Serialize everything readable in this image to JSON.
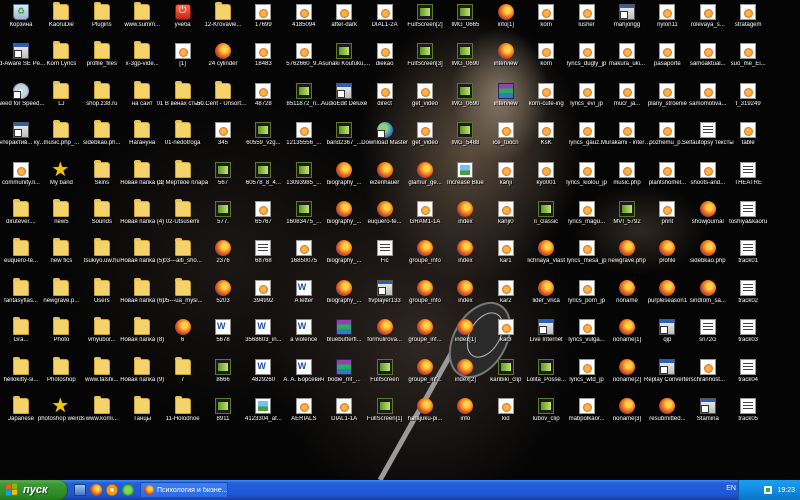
{
  "desktop": {
    "columns": [
      [
        {
          "label": "Корзина",
          "icon": "recycle-bin-icon"
        },
        {
          "label": "Ad-Aware SE Personal",
          "icon": "app-shortcut-icon"
        },
        {
          "label": "Need for Speed...",
          "icon": "game-shortcut-icon"
        },
        {
          "label": "Интерактив... курс игры...",
          "icon": "app-shortcut-icon"
        },
        {
          "label": "community.li...",
          "icon": "html-file-icon"
        },
        {
          "label": "dirutever....",
          "icon": "folder-icon"
        },
        {
          "label": "euquero-te...",
          "icon": "folder-icon"
        },
        {
          "label": "fantasyflas...",
          "icon": "folder-icon"
        },
        {
          "label": "Gra...",
          "icon": "folder-icon"
        },
        {
          "label": "hellokitty-si...",
          "icon": "folder-icon"
        },
        {
          "label": "Japanese",
          "icon": "folder-icon"
        }
      ],
      [
        {
          "label": "KaoruDie",
          "icon": "folder-icon"
        },
        {
          "label": "Korn Lyrics",
          "icon": "folder-icon"
        },
        {
          "label": "LJ",
          "icon": "folder-icon"
        },
        {
          "label": "music.php_...",
          "icon": "folder-icon"
        },
        {
          "label": "My band",
          "icon": "star-icon"
        },
        {
          "label": "new5",
          "icon": "folder-icon"
        },
        {
          "label": "new fics",
          "icon": "folder-icon"
        },
        {
          "label": "newgrave.p...",
          "icon": "folder-icon"
        },
        {
          "label": "Photo",
          "icon": "folder-icon"
        },
        {
          "label": "Photoshop",
          "icon": "folder-icon"
        },
        {
          "label": "photoshop weirds",
          "icon": "star-icon"
        }
      ],
      [
        {
          "label": "Plugins",
          "icon": "folder-icon"
        },
        {
          "label": "profile_files",
          "icon": "folder-icon"
        },
        {
          "label": "shop.z38.ru",
          "icon": "folder-icon"
        },
        {
          "label": "sidebkao.ph...",
          "icon": "folder-icon"
        },
        {
          "label": "Skins",
          "icon": "folder-icon"
        },
        {
          "label": "Sounds",
          "icon": "folder-icon"
        },
        {
          "label": "tsukiyo.uw.hu",
          "icon": "folder-icon"
        },
        {
          "label": "Users",
          "icon": "folder-icon"
        },
        {
          "label": "vmyubor...",
          "icon": "folder-icon"
        },
        {
          "label": "www.falshi...",
          "icon": "folder-icon"
        },
        {
          "label": "www.komi...",
          "icon": "folder-icon"
        }
      ],
      [
        {
          "label": "www.summ...",
          "icon": "folder-icon"
        },
        {
          "label": "x-3gp-vide...",
          "icon": "folder-icon"
        },
        {
          "label": "на сайт",
          "icon": "folder-icon"
        },
        {
          "label": "Нагануна",
          "icon": "folder-icon"
        },
        {
          "label": "Новая папка (3)",
          "icon": "folder-icon"
        },
        {
          "label": "Новая папка (4)",
          "icon": "folder-icon"
        },
        {
          "label": "Новая папка (5)",
          "icon": "folder-icon"
        },
        {
          "label": "Новая папка (6)",
          "icon": "folder-icon"
        },
        {
          "label": "Новая папка (8)",
          "icon": "folder-icon"
        },
        {
          "label": "Новая папка (9)",
          "icon": "folder-icon"
        },
        {
          "label": "Танцы",
          "icon": "folder-icon"
        }
      ],
      [
        {
          "label": "учеба",
          "icon": "app-icon"
        },
        {
          "label": "[1]",
          "icon": "html-file-icon"
        },
        {
          "label": "01 В венах стынет ртуть",
          "icon": "folder-icon"
        },
        {
          "label": "01-nedotroga",
          "icon": "folder-icon"
        },
        {
          "label": "02 Мертвое плаpа",
          "icon": "folder-icon"
        },
        {
          "label": "02-Utsusemi",
          "icon": "folder-icon"
        },
        {
          "label": "03---aiti_sho...",
          "icon": "folder-icon"
        },
        {
          "label": "05---ua_mysi...",
          "icon": "folder-icon"
        },
        {
          "label": "6",
          "icon": "firefox-icon"
        },
        {
          "label": "7",
          "icon": "folder-icon"
        },
        {
          "label": "11-Holodnoe",
          "icon": "folder-icon"
        }
      ],
      [
        {
          "label": "12-Krovavie...",
          "icon": "folder-icon"
        },
        {
          "label": "24 cylinder",
          "icon": "firefox-icon"
        },
        {
          "label": "50 Cent - Unsorted ...",
          "icon": "folder-icon"
        },
        {
          "label": "345",
          "icon": "html-file-icon"
        },
        {
          "label": "567",
          "icon": "media-file-icon"
        },
        {
          "label": "577.",
          "icon": "media-file-icon"
        },
        {
          "label": "2376",
          "icon": "firefox-icon"
        },
        {
          "label": "5203",
          "icon": "firefox-icon"
        },
        {
          "label": "5678",
          "icon": "word-doc-icon"
        },
        {
          "label": "8666",
          "icon": "media-file-icon"
        },
        {
          "label": "8911",
          "icon": "media-file-icon"
        }
      ],
      [
        {
          "label": "17699",
          "icon": "html-file-icon"
        },
        {
          "label": "18483",
          "icon": "html-file-icon"
        },
        {
          "label": "48728",
          "icon": "html-file-icon"
        },
        {
          "label": "60559_vzg...",
          "icon": "media-file-icon"
        },
        {
          "label": "60578_8_4...",
          "icon": "media-file-icon"
        },
        {
          "label": "65767",
          "icon": "html-file-icon"
        },
        {
          "label": "68768",
          "icon": "text-file-icon"
        },
        {
          "label": "394992",
          "icon": "html-file-icon"
        },
        {
          "label": "3568603_in...",
          "icon": "word-doc-icon"
        },
        {
          "label": "4829260",
          "icon": "word-doc-icon"
        },
        {
          "label": "4123304_af...",
          "icon": "image-file-icon"
        }
      ],
      [
        {
          "label": "4185094",
          "icon": "html-file-icon"
        },
        {
          "label": "5762660_9...",
          "icon": "html-file-icon"
        },
        {
          "label": "8511872_n...",
          "icon": "media-file-icon"
        },
        {
          "label": "12135556_...",
          "icon": "html-file-icon"
        },
        {
          "label": "13093985_...",
          "icon": "media-file-icon"
        },
        {
          "label": "16083475_...",
          "icon": "media-file-icon"
        },
        {
          "label": "16850075",
          "icon": "html-file-icon"
        },
        {
          "label": "A letter",
          "icon": "word-doc-icon"
        },
        {
          "label": "a violence",
          "icon": "word-doc-icon"
        },
        {
          "label": "A. A. Борсевич",
          "icon": "word-doc-icon"
        },
        {
          "label": "AERIALS",
          "icon": "html-file-icon"
        }
      ],
      [
        {
          "label": "after-dark",
          "icon": "html-file-icon"
        },
        {
          "label": "Asunaki Koufuku,...",
          "icon": "media-file-icon"
        },
        {
          "label": "AudioEdit Deluxe",
          "icon": "app-shortcut-icon"
        },
        {
          "label": "band2367_...",
          "icon": "media-file-icon"
        },
        {
          "label": "biography_...",
          "icon": "firefox-icon"
        },
        {
          "label": "biography_...",
          "icon": "firefox-icon"
        },
        {
          "label": "biography_...",
          "icon": "firefox-icon"
        },
        {
          "label": "biography_...",
          "icon": "firefox-icon"
        },
        {
          "label": "bluebutterfl...",
          "icon": "winrar-archive-icon"
        },
        {
          "label": "bodie_mf_...",
          "icon": "winrar-archive-icon"
        },
        {
          "label": "DIAL1-1A",
          "icon": "html-file-icon"
        }
      ],
      [
        {
          "label": "DIAL1-2A",
          "icon": "html-file-icon"
        },
        {
          "label": "diekao",
          "icon": "html-file-icon"
        },
        {
          "label": "direct",
          "icon": "html-file-icon"
        },
        {
          "label": "Download Master",
          "icon": "globe-icon"
        },
        {
          "label": "eizenhauer",
          "icon": "firefox-icon"
        },
        {
          "label": "euquero-te...",
          "icon": "firefox-icon"
        },
        {
          "label": "Fic",
          "icon": "text-file-icon"
        },
        {
          "label": "flvplayer133",
          "icon": "app-shortcut-icon"
        },
        {
          "label": "formulirova...",
          "icon": "firefox-icon"
        },
        {
          "label": "FullScreen",
          "icon": "media-file-icon"
        },
        {
          "label": "FullScreen[1]",
          "icon": "media-file-icon"
        }
      ],
      [
        {
          "label": "FullScreen[2]",
          "icon": "media-file-icon"
        },
        {
          "label": "FullScreen[3]",
          "icon": "media-file-icon"
        },
        {
          "label": "get_video",
          "icon": "html-file-icon"
        },
        {
          "label": "get_video",
          "icon": "html-file-icon"
        },
        {
          "label": "glamur_ge...",
          "icon": "firefox-icon"
        },
        {
          "label": "GRAM1-1A",
          "icon": "html-file-icon"
        },
        {
          "label": "groupe_info",
          "icon": "firefox-icon"
        },
        {
          "label": "groupe_info",
          "icon": "firefox-icon"
        },
        {
          "label": "groupe_inf...",
          "icon": "firefox-icon"
        },
        {
          "label": "groupe_inf...",
          "icon": "firefox-icon"
        },
        {
          "label": "harajuku-pi...",
          "icon": "firefox-icon"
        }
      ],
      [
        {
          "label": "IMG_0665",
          "icon": "media-file-icon"
        },
        {
          "label": "IMG_0690",
          "icon": "media-file-icon"
        },
        {
          "label": "IMG_0690",
          "icon": "media-file-icon"
        },
        {
          "label": "IMG_5488",
          "icon": "media-file-icon"
        },
        {
          "label": "Increase Blue",
          "icon": "image-file-icon"
        },
        {
          "label": "index",
          "icon": "firefox-icon"
        },
        {
          "label": "index",
          "icon": "firefox-icon"
        },
        {
          "label": "index",
          "icon": "firefox-icon"
        },
        {
          "label": "index[1]",
          "icon": "firefox-icon"
        },
        {
          "label": "index[2]",
          "icon": "firefox-icon"
        },
        {
          "label": "info",
          "icon": "firefox-icon"
        }
      ],
      [
        {
          "label": "info[1]",
          "icon": "firefox-icon"
        },
        {
          "label": "interview",
          "icon": "firefox-icon"
        },
        {
          "label": "interview",
          "icon": "winrar-archive-icon"
        },
        {
          "label": "ice_tuocn",
          "icon": "html-file-icon"
        },
        {
          "label": "kanji",
          "icon": "html-file-icon"
        },
        {
          "label": "kanji0",
          "icon": "html-file-icon"
        },
        {
          "label": "kar1",
          "icon": "html-file-icon"
        },
        {
          "label": "kar2",
          "icon": "html-file-icon"
        },
        {
          "label": "kar3",
          "icon": "html-file-icon"
        },
        {
          "label": "karibiki_clip",
          "icon": "media-file-icon"
        },
        {
          "label": "kid",
          "icon": "html-file-icon"
        }
      ],
      [
        {
          "label": "korn",
          "icon": "html-file-icon"
        },
        {
          "label": "korn",
          "icon": "html-file-icon"
        },
        {
          "label": "korn-cute-ing",
          "icon": "html-file-icon"
        },
        {
          "label": "KsK",
          "icon": "html-file-icon"
        },
        {
          "label": "kyo001",
          "icon": "html-file-icon"
        },
        {
          "label": "li_classic",
          "icon": "media-file-icon"
        },
        {
          "label": "lichnaya_vlast",
          "icon": "firefox-icon"
        },
        {
          "label": "lider_vrica",
          "icon": "firefox-icon"
        },
        {
          "label": "Live Internet",
          "icon": "app-shortcut-icon"
        },
        {
          "label": "Lolita_Posse...",
          "icon": "media-file-icon"
        },
        {
          "label": "lubov_clip",
          "icon": "media-file-icon"
        }
      ],
      [
        {
          "label": "lusher",
          "icon": "html-file-icon"
        },
        {
          "label": "lyrics_dugly_jp",
          "icon": "html-file-icon"
        },
        {
          "label": "lyrics_evi_jp",
          "icon": "html-file-icon"
        },
        {
          "label": "lyrics_gauz...",
          "icon": "html-file-icon"
        },
        {
          "label": "lyrics_kiolou_jp",
          "icon": "html-file-icon"
        },
        {
          "label": "lyrics_magu...",
          "icon": "html-file-icon"
        },
        {
          "label": "lyrics_mesa_jp",
          "icon": "html-file-icon"
        },
        {
          "label": "lyrics_porn_jp",
          "icon": "html-file-icon"
        },
        {
          "label": "lyrics_vulga...",
          "icon": "html-file-icon"
        },
        {
          "label": "lyrics_wtd_jp",
          "icon": "html-file-icon"
        },
        {
          "label": "mabpolkaor...",
          "icon": "html-file-icon"
        }
      ],
      [
        {
          "label": "mahjongg",
          "icon": "app-shortcut-icon"
        },
        {
          "label": "makura_uki...",
          "icon": "html-file-icon"
        },
        {
          "label": "mucr_ja...",
          "icon": "html-file-icon"
        },
        {
          "label": "Murakami - interview",
          "icon": "html-file-icon"
        },
        {
          "label": "music.php",
          "icon": "html-file-icon"
        },
        {
          "label": "MVI_5792",
          "icon": "media-file-icon"
        },
        {
          "label": "newgrave.php",
          "icon": "firefox-icon"
        },
        {
          "label": "noname",
          "icon": "firefox-icon"
        },
        {
          "label": "noname[1]",
          "icon": "firefox-icon"
        },
        {
          "label": "noname[2]",
          "icon": "firefox-icon"
        },
        {
          "label": "noname[3]",
          "icon": "firefox-icon"
        }
      ],
      [
        {
          "label": "nylon11",
          "icon": "html-file-icon"
        },
        {
          "label": "pasaporte",
          "icon": "html-file-icon"
        },
        {
          "label": "plany_stroenie",
          "icon": "html-file-icon"
        },
        {
          "label": "pozhemu_p...",
          "icon": "html-file-icon"
        },
        {
          "label": "plantshomel...",
          "icon": "html-file-icon"
        },
        {
          "label": "print",
          "icon": "html-file-icon"
        },
        {
          "label": "profile",
          "icon": "firefox-icon"
        },
        {
          "label": "purpleseason1",
          "icon": "firefox-icon"
        },
        {
          "label": "qip",
          "icon": "app-shortcut-icon"
        },
        {
          "label": "Replay Converter",
          "icon": "app-shortcut-icon"
        },
        {
          "label": "resubmitted...",
          "icon": "firefox-icon"
        }
      ],
      [
        {
          "label": "rolevaya_s...",
          "icon": "html-file-icon"
        },
        {
          "label": "samoaktual...",
          "icon": "html-file-icon"
        },
        {
          "label": "samomotiva...",
          "icon": "html-file-icon"
        },
        {
          "label": "Selfautopsy тексты",
          "icon": "text-file-icon"
        },
        {
          "label": "shoots-and...",
          "icon": "html-file-icon"
        },
        {
          "label": "showjournal",
          "icon": "firefox-icon"
        },
        {
          "label": "sidebkao.php",
          "icon": "firefox-icon"
        },
        {
          "label": "sindrom_sa...",
          "icon": "firefox-icon"
        },
        {
          "label": "sn72ci",
          "icon": "text-file-icon"
        },
        {
          "label": "schrannost...",
          "icon": "html-file-icon"
        },
        {
          "label": "Stamina",
          "icon": "app-shortcut-icon"
        }
      ],
      [
        {
          "label": "stratagem",
          "icon": "html-file-icon"
        },
        {
          "label": "suo_me_Ei...",
          "icon": "html-file-icon"
        },
        {
          "label": "t_319249",
          "icon": "html-file-icon"
        },
        {
          "label": "table",
          "icon": "html-file-icon"
        },
        {
          "label": "THEATRE",
          "icon": "text-file-icon"
        },
        {
          "label": "toshiya&kaoru",
          "icon": "text-file-icon"
        },
        {
          "label": "track01",
          "icon": "text-file-icon"
        },
        {
          "label": "track02",
          "icon": "text-file-icon"
        },
        {
          "label": "track03",
          "icon": "text-file-icon"
        },
        {
          "label": "track04",
          "icon": "text-file-icon"
        },
        {
          "label": "track05",
          "icon": "text-file-icon"
        }
      ]
    ]
  },
  "taskbar": {
    "start_label": "пуск",
    "quick_launch": [
      "desktop-icon",
      "firefox-icon",
      "media-player-icon",
      "messenger-icon"
    ],
    "window_button_label": "Психология и бизне...",
    "language": "EN",
    "clock": "19:23"
  },
  "colors": {
    "taskbar_blue": "#245edb",
    "start_green": "#3c9a35",
    "tray_blue": "#0f87dd",
    "folder_yellow": "#f3d36a"
  }
}
